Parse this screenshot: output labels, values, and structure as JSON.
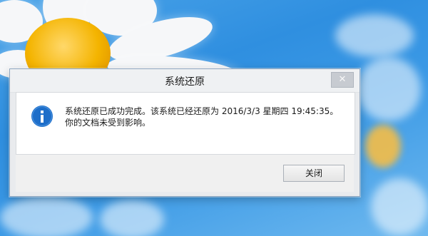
{
  "dialog": {
    "title": "系统还原",
    "close_glyph": "✕",
    "message_line1": "系统还原已成功完成。该系统已经还原为 2016/3/3 星期四 19:45:35。",
    "message_line2": "你的文档未受到影响。",
    "close_button_label": "关闭",
    "icon": "info-icon"
  },
  "colors": {
    "info_icon": "#1e6ec9",
    "desktop": "#3c9ae6"
  }
}
